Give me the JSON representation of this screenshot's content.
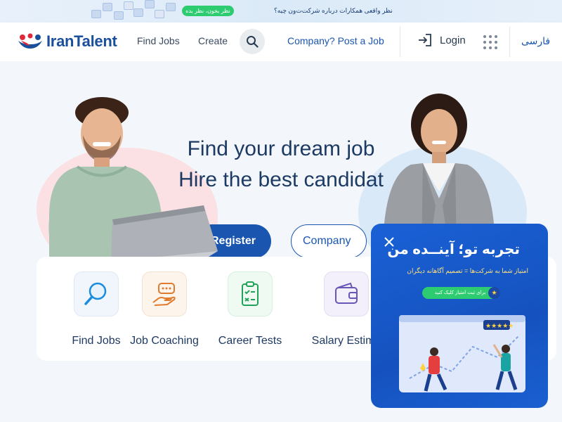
{
  "promo": {
    "pill_label": "نظر بخون، نظر بده",
    "text": "نظر واقعی همکارات درباره شرکت‌ت‌ون چیه؟"
  },
  "header": {
    "logo_text": "IranTalent",
    "nav": [
      "Find Jobs",
      "Create"
    ],
    "search_icon": "search-icon",
    "company_link": "Company? Post a Job",
    "login_label": "Login",
    "apps_icon": "grid-icon",
    "lang_label": "فارسی"
  },
  "hero": {
    "title": "Find your dream job",
    "subtitle": "Hire the best candidat",
    "register_label": "Register",
    "company_label": "Company"
  },
  "categories": [
    {
      "label": "Find Jobs",
      "icon": "magnifier-icon"
    },
    {
      "label": "Job Coaching",
      "icon": "coaching-hand-icon"
    },
    {
      "label": "Career Tests",
      "icon": "clipboard-checklist-icon"
    },
    {
      "label": "Salary Estima",
      "icon": "wallet-icon"
    }
  ],
  "popup": {
    "title": "تجربه تو؛ آینــده من",
    "subtitle": "امتیاز شما به شرکت‌ها = تصمیم آگاهانه دیگران",
    "cta": "برای ثبت امتیاز کلیک کنید",
    "close_icon": "close-icon",
    "star_icon": "star-icon",
    "rating_stars": "★★★★★"
  },
  "colors": {
    "brand_blue": "#1a56b0",
    "logo_red": "#e0283a",
    "popup_blue": "#1552bf",
    "green": "#2ecc71"
  }
}
